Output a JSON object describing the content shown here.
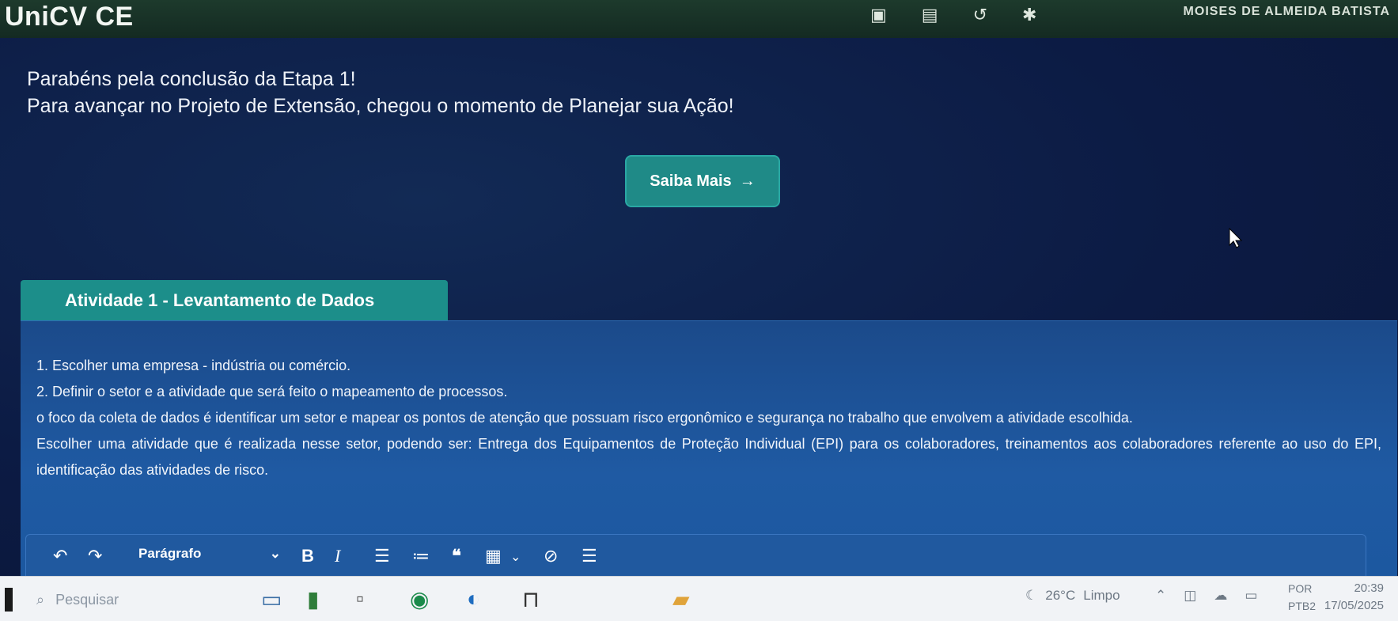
{
  "app": {
    "title": "UniCV CE",
    "top_right": "MOISES DE ALMEIDA BATISTA"
  },
  "intro": {
    "line1": "Parabéns pela conclusão da Etapa 1!",
    "line2": "Para avançar no Projeto de Extensão, chegou o momento de Planejar sua Ação!",
    "button_label": "Saiba Mais",
    "button_arrow": "→"
  },
  "activity": {
    "tab_label": "Atividade 1 - Levantamento de Dados",
    "paragraphs": [
      "1. Escolher uma empresa - indústria ou comércio.",
      "2. Definir o setor e a atividade que será feito o mapeamento de processos.",
      "o foco da coleta de dados é identificar um setor e mapear os pontos de atenção que possuam risco ergonômico e segurança no trabalho que envolvem a atividade escolhida.",
      "Escolher uma atividade que é realizada nesse setor, podendo ser: Entrega dos Equipamentos de Proteção Individual (EPI) para os colaboradores, treinamentos aos colaboradores referente ao uso do EPI, identificação das atividades de risco."
    ]
  },
  "editor": {
    "format_label": "Parágrafo",
    "buttons": [
      "undo-icon",
      "redo-icon",
      "bold-icon",
      "italic-icon",
      "bulleted-list-icon",
      "numbered-list-icon",
      "quote-icon",
      "table-icon",
      "link-icon",
      "indent-icon"
    ]
  },
  "taskbar": {
    "search_placeholder": "Pesquisar",
    "weather_temp": "26°C",
    "weather_desc": "Limpo",
    "lang_top": "POR",
    "lang_bottom": "PTB2",
    "time": "20:39",
    "date": "17/05/2025"
  },
  "colors": {
    "accent": "#1f8a87",
    "card": "#1f5aa3",
    "background": "#0c1b44"
  }
}
